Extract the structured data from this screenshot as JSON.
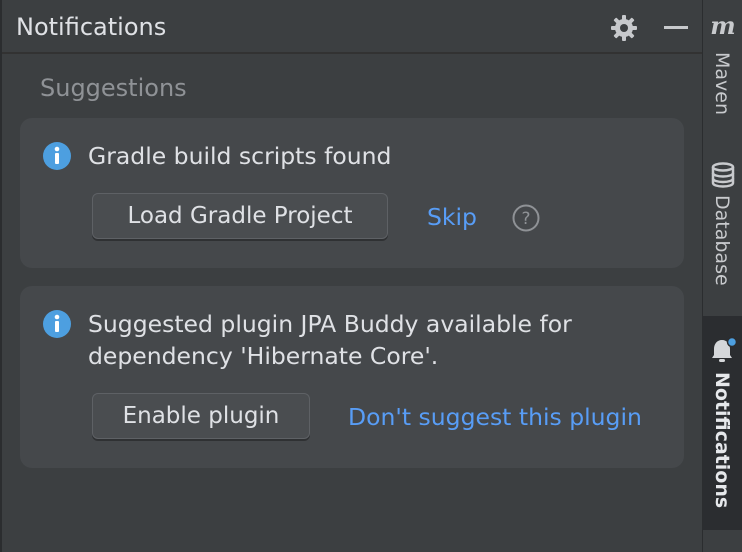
{
  "header": {
    "title": "Notifications",
    "settings_icon": "gear-icon",
    "minimize_icon": "minimize-icon"
  },
  "section": {
    "label": "Suggestions"
  },
  "notifications": [
    {
      "icon": "info-icon",
      "message_lines": [
        "Gradle build scripts found"
      ],
      "primary_button": "Load Gradle Project",
      "secondary_link": "Skip",
      "help_icon": "question-icon"
    },
    {
      "icon": "info-icon",
      "message_lines": [
        "Suggested plugin JPA Buddy available for",
        "dependency 'Hibernate Core'."
      ],
      "primary_button": "Enable plugin",
      "secondary_link": "Don't suggest this plugin"
    }
  ],
  "tool_strip": {
    "items": [
      {
        "label": "Maven",
        "icon": "maven-icon",
        "glyph": "m",
        "active": false
      },
      {
        "label": "Database",
        "icon": "database-icon",
        "active": false
      },
      {
        "label": "Notifications",
        "icon": "bell-icon",
        "active": true,
        "has_badge": true
      }
    ]
  },
  "colors": {
    "background": "#3c3f41",
    "card": "#45484b",
    "link": "#589df6",
    "info": "#4d9fe0",
    "text": "#dfe1e5",
    "muted": "#8f9296"
  }
}
